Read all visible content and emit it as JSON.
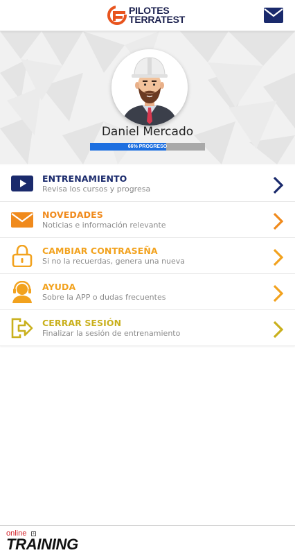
{
  "header": {
    "logo_line1": "PILOTES",
    "logo_line2": "TERRATEST",
    "mail_icon": "envelope-icon"
  },
  "profile": {
    "name": "Daniel Mercado",
    "progress_percent": 66,
    "progress_label": "66% PROGRESO",
    "progress_color": "#1d6fe0"
  },
  "menu": {
    "items": [
      {
        "title": "ENTRENAMIENTO",
        "subtitle": "Revisa los cursos y progresa",
        "icon": "video-play-icon",
        "color": "#1a2a6c"
      },
      {
        "title": "NOVEDADES",
        "subtitle": "Noticias e información relevante",
        "icon": "envelope-icon",
        "color": "#f08a1c"
      },
      {
        "title": "CAMBIAR CONTRASEÑA",
        "subtitle": "Si no la recuerdas, genera una nueva",
        "icon": "padlock-icon",
        "color": "#f2a21e"
      },
      {
        "title": "AYUDA",
        "subtitle": "Sobre la APP o dudas frecuentes",
        "icon": "support-headset-icon",
        "color": "#f2a21e"
      },
      {
        "title": "CERRAR SESIÓN",
        "subtitle": "Finalizar la sesión de entrenamiento",
        "icon": "logout-arrow-icon",
        "color": "#c9b01c"
      }
    ]
  },
  "footer": {
    "online": "online",
    "training": "TRAINING"
  }
}
